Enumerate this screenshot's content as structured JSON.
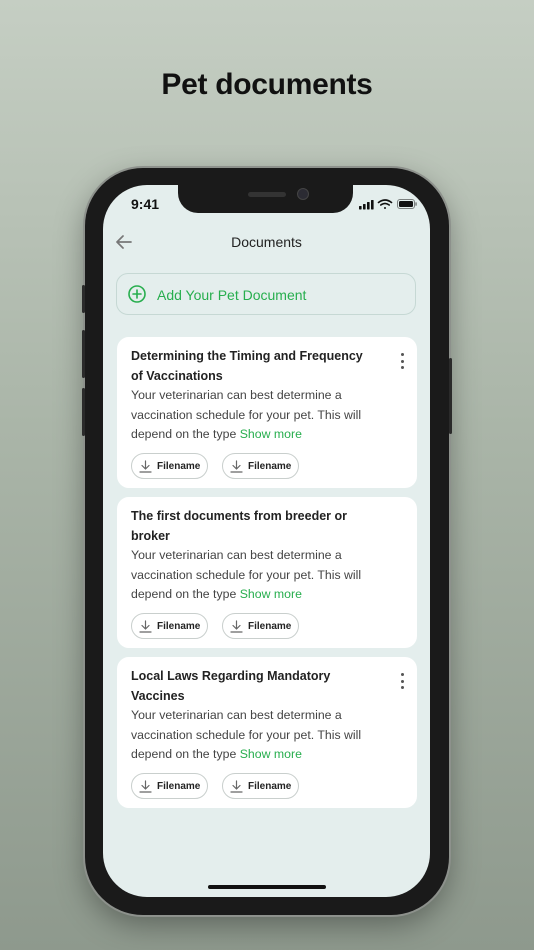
{
  "promo": {
    "title": "Pet documents"
  },
  "status_bar": {
    "time": "9:41"
  },
  "header": {
    "title": "Documents"
  },
  "add_button": {
    "label": "Add Your Pet Document"
  },
  "documents": [
    {
      "title": "Determining the Timing and Frequency of Vaccinations",
      "body": "Your veterinarian can best determine a vaccination schedule for your pet. This will depend on the type",
      "show_more": "Show more",
      "files": [
        "Filename",
        "Filename"
      ],
      "has_menu": true
    },
    {
      "title": "The first documents from breeder or broker",
      "body": "Your veterinarian can best determine a vaccination schedule for your pet. This will depend on the type",
      "show_more": "Show more",
      "files": [
        "Filename",
        "Filename"
      ],
      "has_menu": false
    },
    {
      "title": "Local Laws Regarding Mandatory Vaccines",
      "body": "Your veterinarian can best determine a vaccination schedule for your pet. This will depend on the type",
      "show_more": "Show more",
      "files": [
        "Filename",
        "Filename"
      ],
      "has_menu": true
    }
  ],
  "icons": {
    "back": "arrow-left-icon",
    "add": "plus-circle-icon",
    "menu": "more-vertical-icon",
    "download": "download-icon",
    "signal": "signal-icon",
    "wifi": "wifi-icon",
    "battery": "battery-icon"
  },
  "colors": {
    "accent": "#27ae4e",
    "screen_bg": "#e4eeed",
    "card_bg": "#ffffff"
  }
}
